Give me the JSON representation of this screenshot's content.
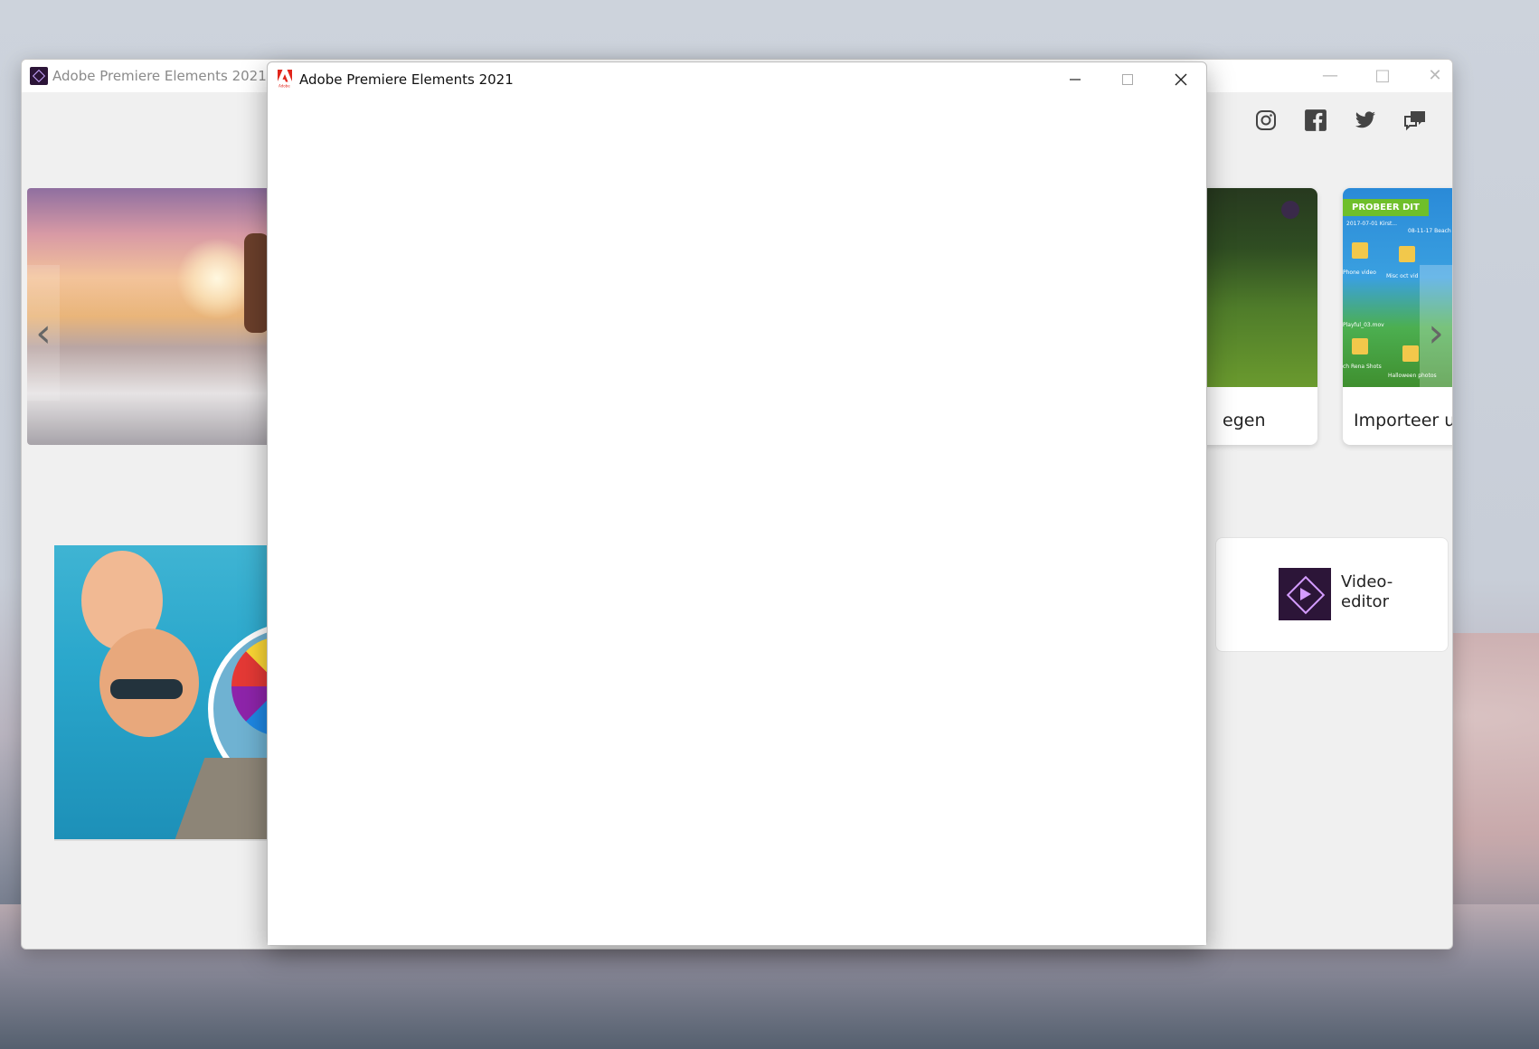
{
  "back_window": {
    "title": "Adobe Premiere Elements 2021",
    "cards": [
      {
        "label": "egen"
      },
      {
        "label": "Importeer uw",
        "badge": "PROBEER DIT"
      }
    ],
    "video_editor": {
      "label": "Video-\neditor"
    },
    "social_icons": [
      "instagram-icon",
      "facebook-icon",
      "twitter-icon",
      "feedback-icon"
    ]
  },
  "dialog": {
    "title": "Adobe Premiere Elements 2021"
  },
  "thumbnail_texts": {
    "folder1": "2017-07-01 Kirst...",
    "folder2": "08-11-17 Beach",
    "folder3": "Phone video",
    "folder4": "Misc oct vid",
    "folder5": "Playful_03.mov",
    "folder6": "ch Rena Shots",
    "folder7": "Halloween photos"
  }
}
